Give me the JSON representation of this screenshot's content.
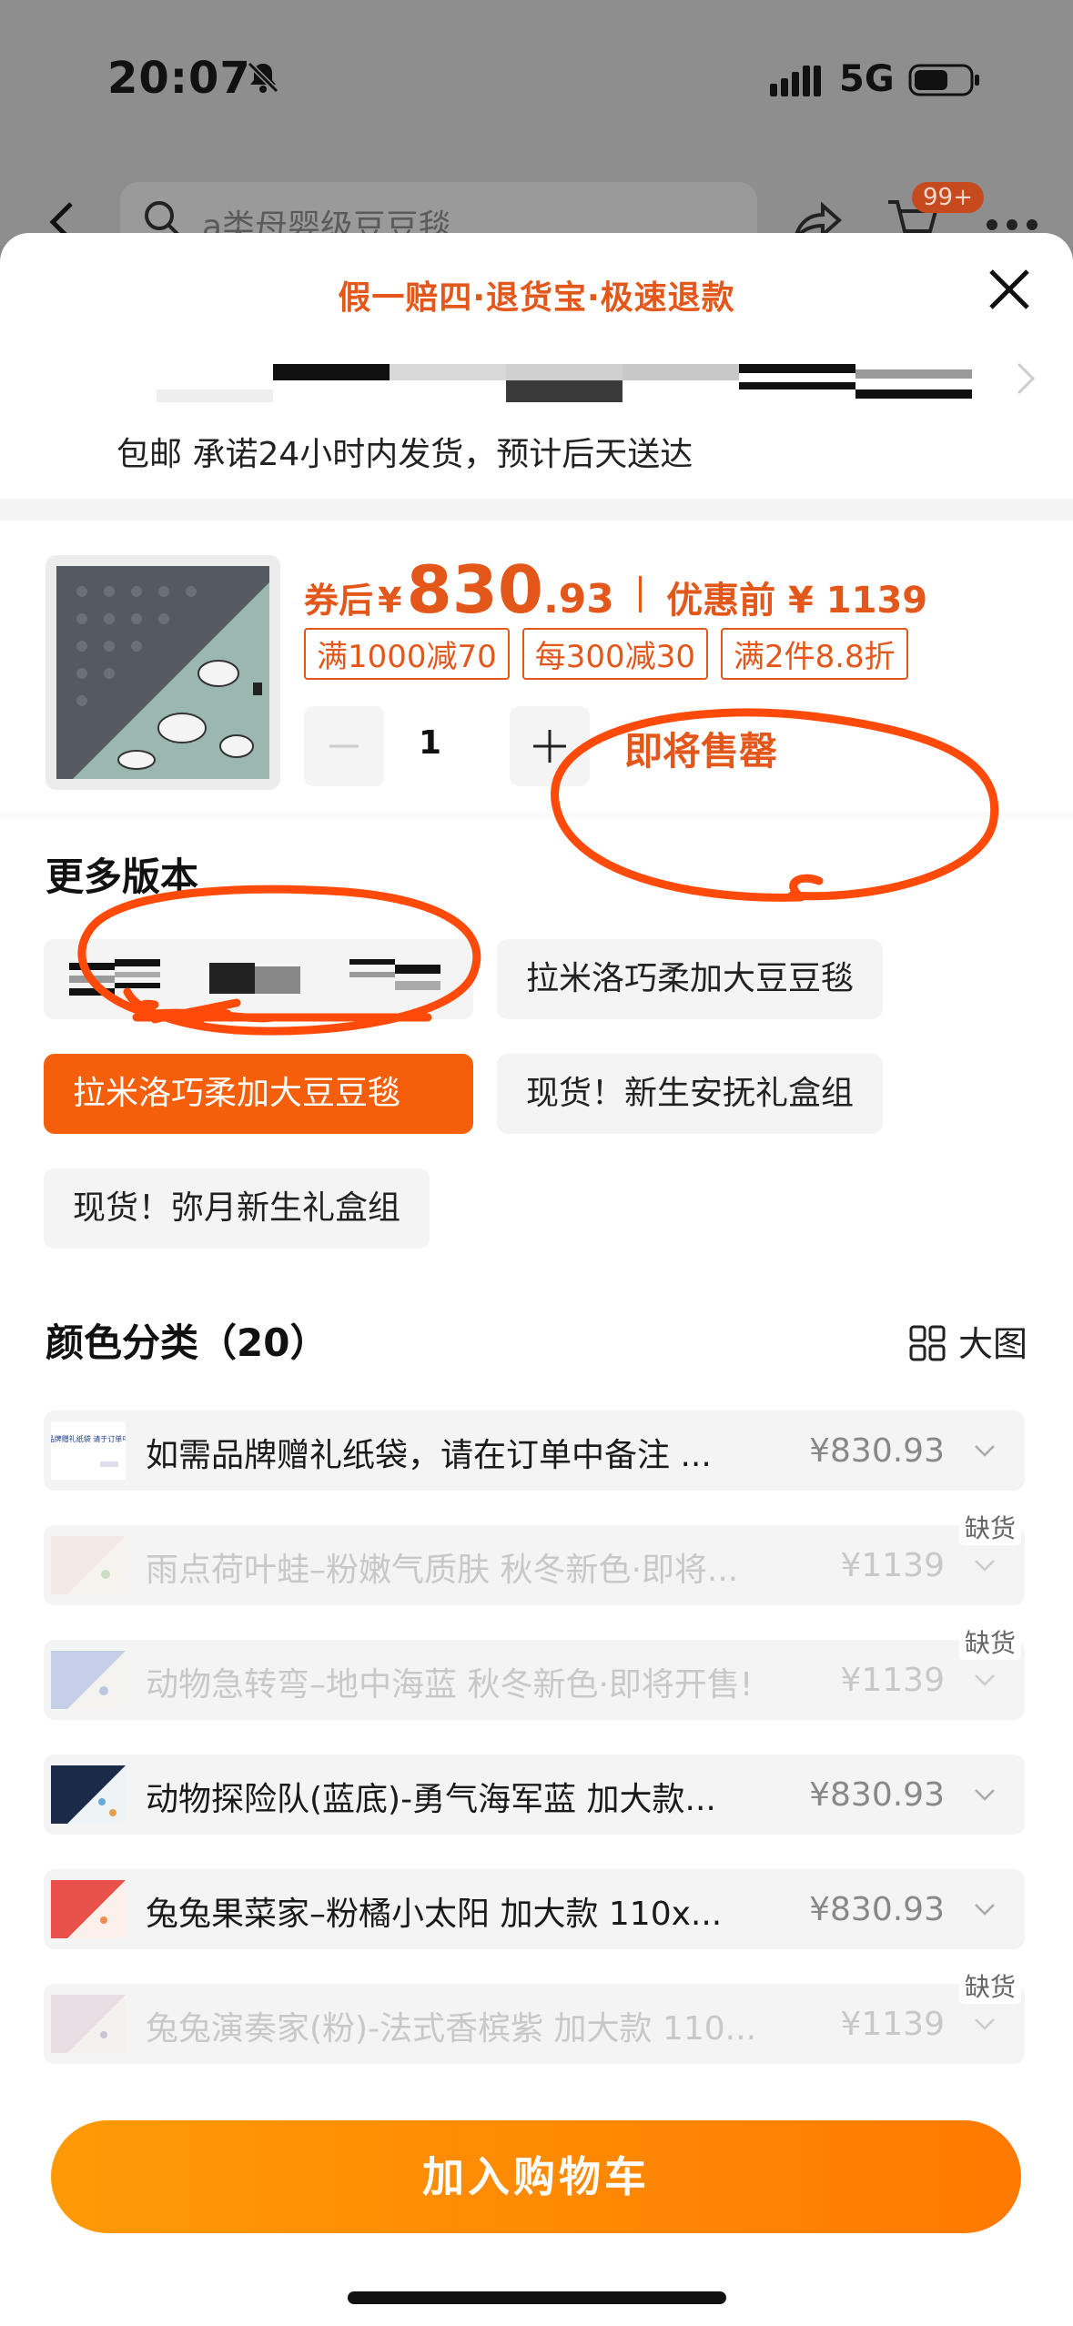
{
  "status_bar": {
    "time": "20:07",
    "network": "5G"
  },
  "background_nav": {
    "search_text": "a类母婴级豆豆毯",
    "cart_badge": "99+"
  },
  "sheet": {
    "guarantee": "假一赔四·退货宝·极速退款",
    "shipping": "包邮 承诺24小时内发货，预计后天送达"
  },
  "product": {
    "price_label": "券后",
    "currency": "¥",
    "price_int": "830",
    "price_dec": ".93",
    "orig_price": "优惠前 ¥ 1139",
    "promos": [
      "满1000减70",
      "每300减30",
      "满2件8.8折"
    ],
    "quantity": "1",
    "stock_status": "即将售罄"
  },
  "versions": {
    "title": "更多版本",
    "items": [
      {
        "label": ""
      },
      {
        "label": "拉米洛巧柔加大豆豆毯"
      },
      {
        "label": "拉米洛巧柔加大豆豆毯",
        "selected": true
      },
      {
        "label": "现货！新生安抚礼盒组"
      },
      {
        "label": "现货！弥月新生礼盒组"
      }
    ]
  },
  "colors": {
    "title": "颜色分类（20）",
    "big_view": "大图",
    "items": [
      {
        "name": "如需品牌赠礼纸袋，请在订单中备注 ...",
        "price": "¥830.93",
        "out_of_stock": false,
        "thumb_text": "如需品牌赠礼纸袋 请于订单中备注"
      },
      {
        "name": "雨点荷叶蛙–粉嫩气质肤 秋冬新色·即将...",
        "price": "¥1139",
        "out_of_stock": true
      },
      {
        "name": "动物急转弯–地中海蓝 秋冬新色·即将开售!",
        "price": "¥1139",
        "out_of_stock": true
      },
      {
        "name": "动物探险队(蓝底)-勇气海军蓝 加大款...",
        "price": "¥830.93",
        "out_of_stock": false
      },
      {
        "name": "兔兔果菜家–粉橘小太阳 加大款 110x...",
        "price": "¥830.93",
        "out_of_stock": false
      },
      {
        "name": "兔兔演奏家(粉)-法式香槟紫 加大款 110...",
        "price": "¥1139",
        "out_of_stock": true
      }
    ],
    "oos_label": "缺货"
  },
  "add_to_cart": "加入购物车",
  "colors_theme": {
    "accent": "#e4571b",
    "button_start": "#ff9a06",
    "button_end": "#ff7a00",
    "selected": "#f55e0a"
  }
}
